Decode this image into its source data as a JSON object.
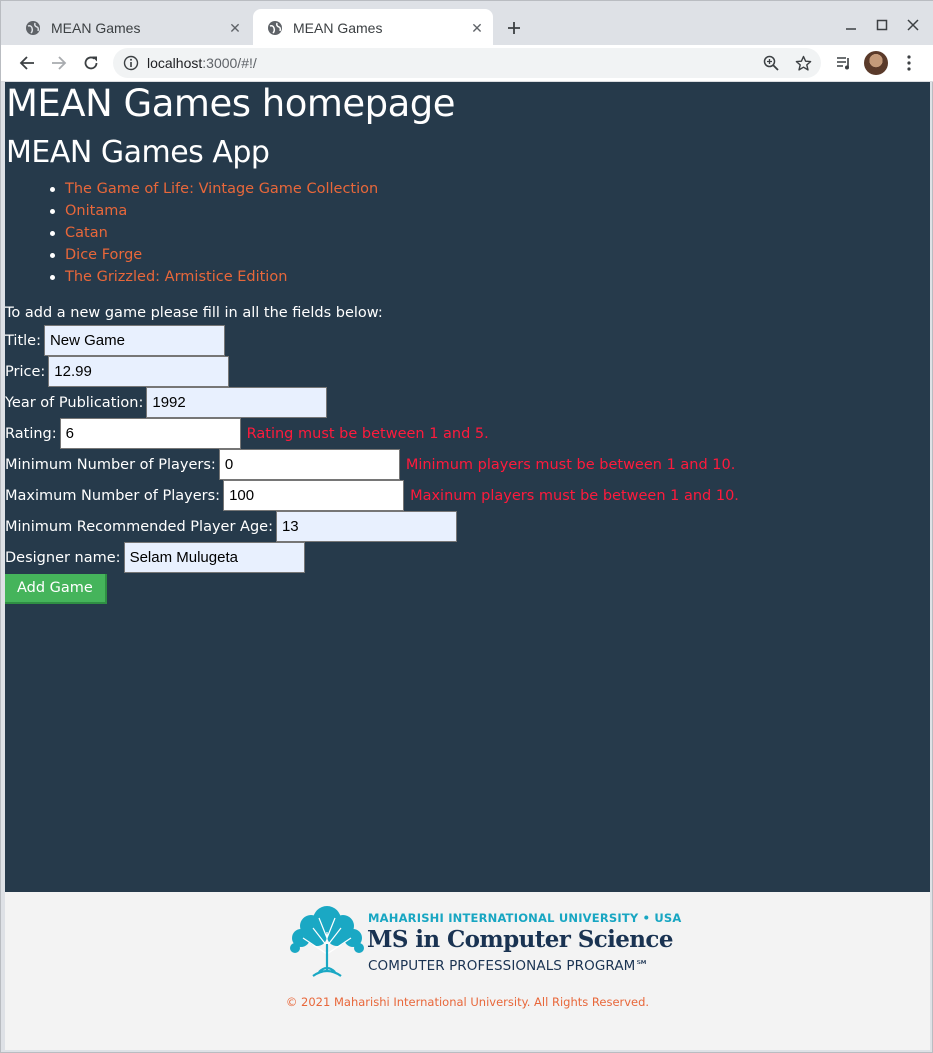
{
  "browser": {
    "tabs": [
      {
        "title": "MEAN Games",
        "active": false
      },
      {
        "title": "MEAN Games",
        "active": true
      }
    ],
    "url_host": "localhost",
    "url_path": ":3000/#!/",
    "icons": [
      "globe-icon",
      "close-icon",
      "new-tab-icon",
      "minimize-icon",
      "maximize-icon",
      "window-close-icon",
      "back-icon",
      "forward-icon",
      "reload-icon",
      "info-icon",
      "zoom-icon",
      "bookmark-star-icon",
      "media-queue-icon",
      "avatar",
      "menu-icon"
    ]
  },
  "page": {
    "heading": "MEAN Games homepage",
    "app_title": "MEAN Games App",
    "games": [
      "The Game of Life: Vintage Game Collection",
      "Onitama",
      "Catan",
      "Dice Forge",
      "The Grizzled: Armistice Edition"
    ],
    "form": {
      "intro": "To add a new game please fill in all the fields below:",
      "title": {
        "label": "Title:",
        "value": "New Game"
      },
      "price": {
        "label": "Price:",
        "value": "12.99"
      },
      "year": {
        "label": "Year of Publication:",
        "value": "1992"
      },
      "rating": {
        "label": "Rating:",
        "value": "6",
        "error": "Rating must be between 1 and 5."
      },
      "min_players": {
        "label": "Minimum Number of Players:",
        "value": "0",
        "error": "Minimum players must be between 1 and 10."
      },
      "max_players": {
        "label": "Maximum Number of Players:",
        "value": "100",
        "error": "Maxinum players must be between 1 and 10."
      },
      "min_age": {
        "label": "Minimum Recommended Player Age:",
        "value": "13"
      },
      "designer": {
        "label": "Designer name:",
        "value": "Selam Mulugeta"
      },
      "submit_label": "Add Game"
    }
  },
  "footer": {
    "university": "MAHARISHI INTERNATIONAL UNIVERSITY • USA",
    "program": "MS in Computer Science",
    "subprogram": "COMPUTER PROFESSIONALS PROGRAM℠",
    "copyright": "© 2021 Maharishi International University. All Rights Reserved."
  },
  "colors": {
    "page_bg": "#263a4b",
    "link": "#e8673a",
    "error": "#ff1a3c",
    "button": "#45b45b",
    "input_autofill": "#e8f0fe"
  }
}
